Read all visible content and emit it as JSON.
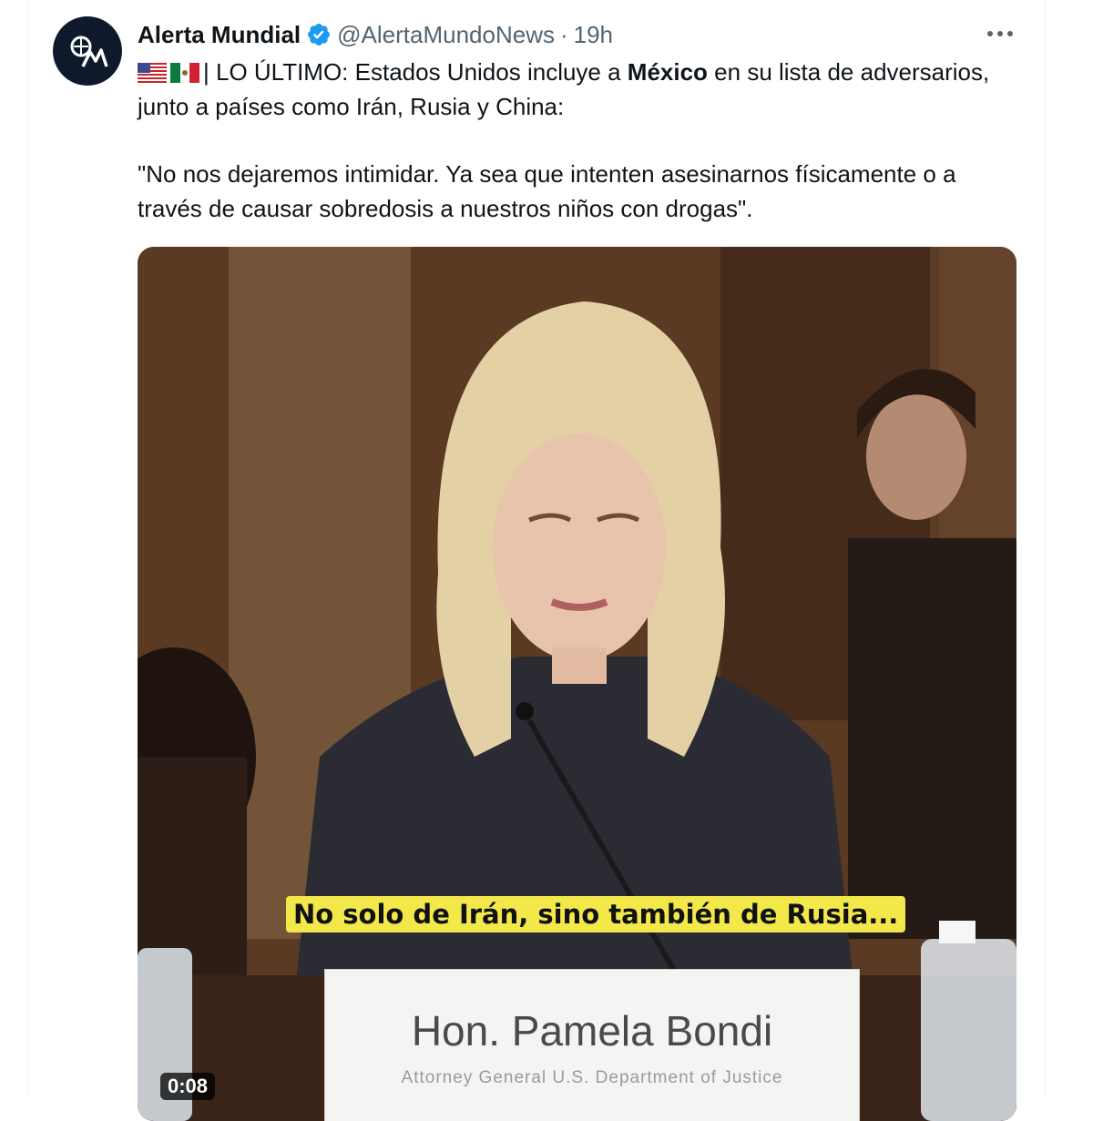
{
  "tweet": {
    "author_name": "Alerta Mundial",
    "author_handle": "@AlertaMundoNews",
    "separator": "·",
    "time": "19h",
    "more_label": "···",
    "flags": [
      "flag-us",
      "flag-mx"
    ],
    "line1_prefix": "| LO ÚLTIMO: Estados Unidos incluye a ",
    "line1_bold": "México",
    "line1_suffix": " en su lista de adversarios, junto a países como Irán, Rusia y China:",
    "quote": "\"No nos dejaremos intimidar. Ya sea que intenten asesinarnos físicamente o a través de causar sobredosis a nuestros niños con drogas\"."
  },
  "video": {
    "caption": "No solo de Irán, sino también de Rusia...",
    "nameplate_name": "Hon. Pamela Bondi",
    "nameplate_title": "Attorney General U.S. Department of Justice",
    "timestamp": "0:08"
  },
  "colors": {
    "verified": "#1d9bf0",
    "secondary_text": "#536471",
    "caption_bg": "#f3e84a"
  }
}
